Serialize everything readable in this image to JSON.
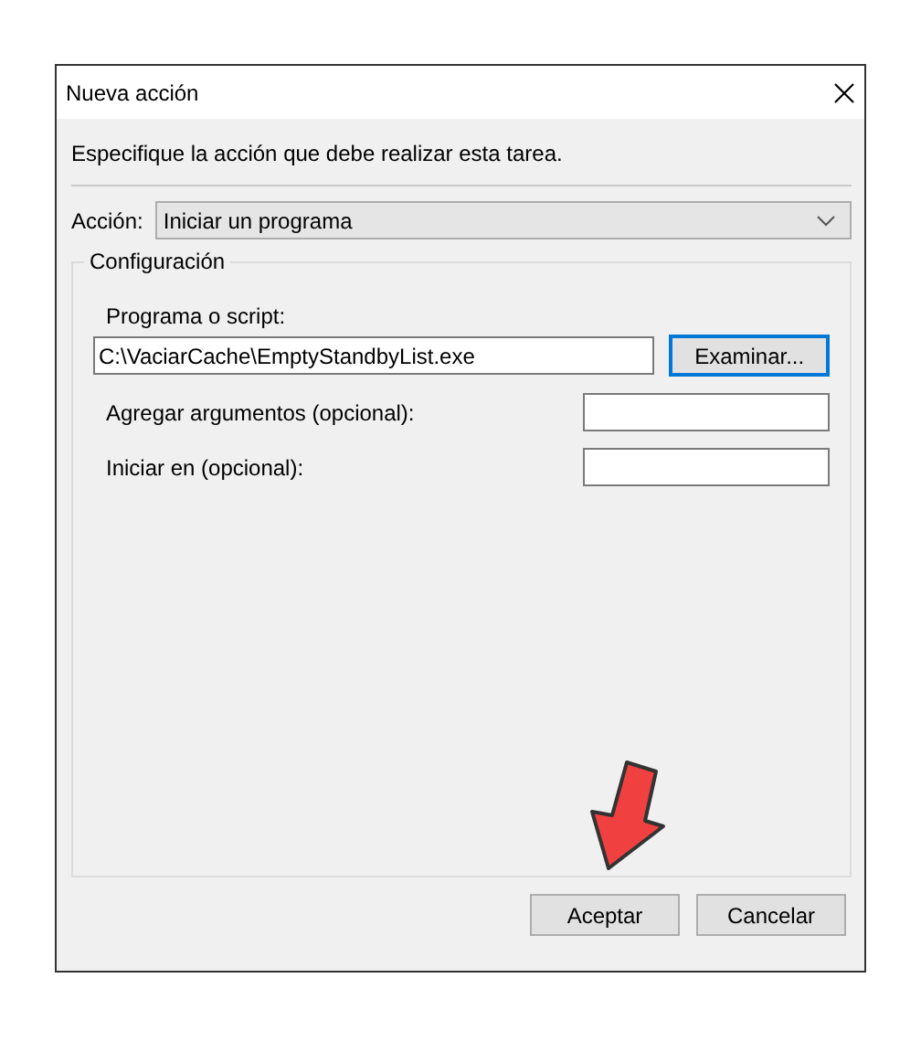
{
  "window": {
    "title": "Nueva acción"
  },
  "instruction": "Especifique la acción que debe realizar esta tarea.",
  "action": {
    "label": "Acción:",
    "value": "Iniciar un programa"
  },
  "settings": {
    "title": "Configuración",
    "program": {
      "label": "Programa o script:",
      "value": "C:\\VaciarCache\\EmptyStandbyList.exe",
      "button": {
        "label": "Examinar...",
        "focused": true
      }
    },
    "fields": [
      {
        "label": "Agregar argumentos (opcional):"
      },
      {
        "label": "Iniciar en (opcional):"
      }
    ]
  },
  "buttons": [
    {
      "label": "Aceptar",
      "focused": false
    },
    {
      "label": "Cancelar",
      "focused": false
    }
  ]
}
